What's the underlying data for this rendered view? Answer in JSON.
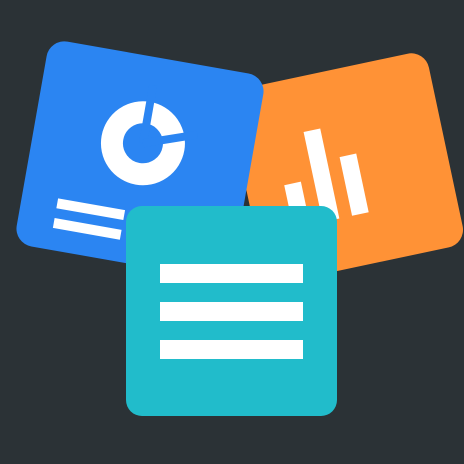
{
  "icon": {
    "name": "documents-app-icon",
    "background_color": "#2b3236",
    "cards": [
      {
        "name": "report-card",
        "color": "#2b85f2",
        "icon": "donut-chart-icon",
        "glyph_color": "#ffffff"
      },
      {
        "name": "chart-card",
        "color": "#ff9236",
        "icon": "bar-chart-icon",
        "glyph_color": "#ffffff"
      },
      {
        "name": "document-card",
        "color": "#21bccb",
        "icon": "text-lines-icon",
        "glyph_color": "#ffffff"
      }
    ]
  }
}
